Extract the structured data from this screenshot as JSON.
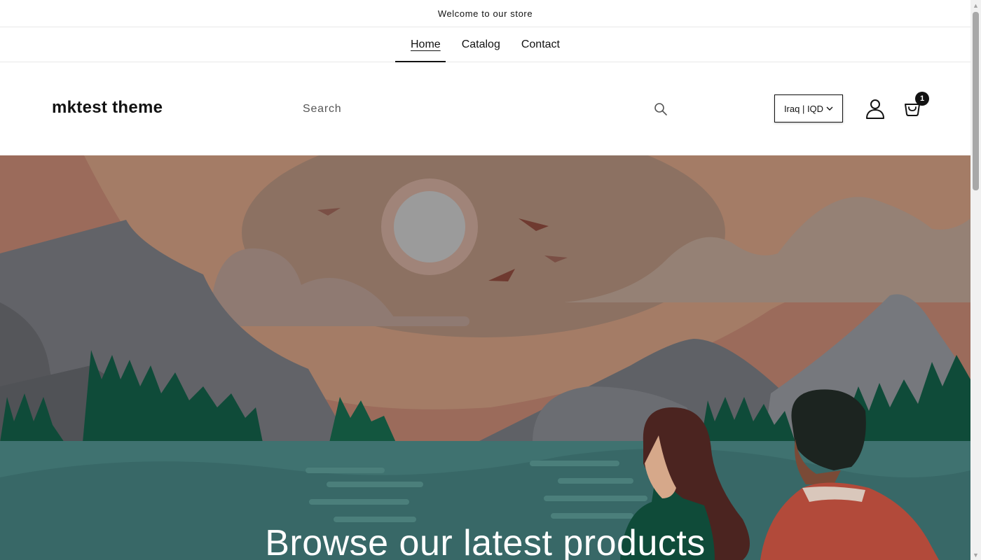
{
  "announcement": "Welcome to our store",
  "nav": {
    "items": [
      {
        "label": "Home",
        "active": true
      },
      {
        "label": "Catalog"
      },
      {
        "label": "Contact"
      }
    ]
  },
  "header": {
    "logo": "mktest theme",
    "search": {
      "placeholder": "Search"
    },
    "country": "Iraq | IQD",
    "cart_count": "1"
  },
  "hero": {
    "title": "Browse our latest products"
  },
  "icons": [
    "search-icon",
    "chevron-down-icon",
    "account-icon",
    "cart-icon"
  ],
  "colors": {
    "text": "#121212",
    "hero_sky": "#9a6c5c",
    "hero_water": "#3f7270",
    "hero_trees": "#0f4b39"
  }
}
